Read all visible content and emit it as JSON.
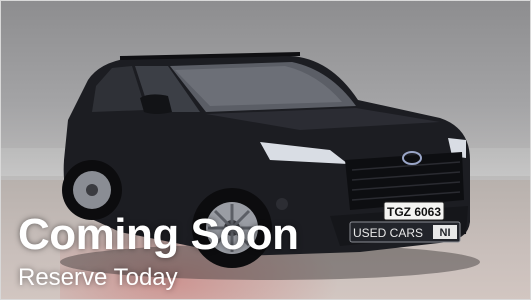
{
  "overlay": {
    "title": "Coming Soon",
    "subtitle": "Reserve Today"
  },
  "vehicle": {
    "plate": "TGZ 6063",
    "dealer_plate_label": "USED CARS",
    "dealer_plate_suffix": "NI",
    "color": "#1c1d22"
  }
}
